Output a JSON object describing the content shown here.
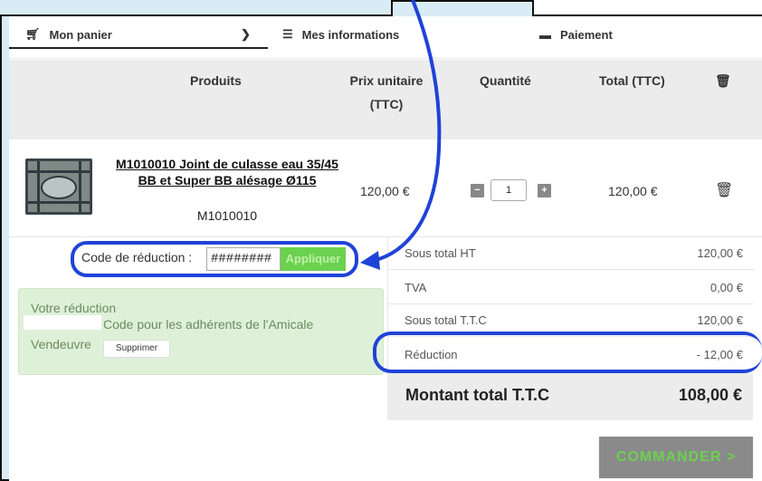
{
  "steps": [
    {
      "label": "Mon panier",
      "icon": "cart-icon"
    },
    {
      "label": "Mes informations",
      "icon": "list-icon"
    },
    {
      "label": "Paiement",
      "icon": "card-icon"
    }
  ],
  "table": {
    "headers": {
      "products": "Produits",
      "unit_price_line1": "Prix unitaire",
      "unit_price_line2": "(TTC)",
      "quantity": "Quantité",
      "total": "Total (TTC)"
    },
    "row": {
      "name": "M1010010 Joint de culasse eau 35/45 BB et Super BB alésage Ø115",
      "ref": "M1010010",
      "unit_price": "120,00 €",
      "quantity": "1",
      "total": "120,00 €"
    }
  },
  "discount": {
    "label": "Code de réduction :",
    "code_value": "########",
    "apply_label": "Appliquer",
    "box_title": "Votre réduction",
    "box_line2": "Code pour les adhérents de l'Amicale",
    "box_line3": "Vendeuvre",
    "remove_label": "Supprimer"
  },
  "totals": [
    {
      "label": "Sous total HT",
      "value": "120,00 €"
    },
    {
      "label": "TVA",
      "value": "0,00 €"
    },
    {
      "label": "Sous total T.T.C",
      "value": "120,00 €"
    },
    {
      "label": "Réduction",
      "value": "- 12,00 €"
    }
  ],
  "grand_total": {
    "label": "Montant total T.T.C",
    "value": "108,00 €"
  },
  "order_button": "COMMANDER  >",
  "colors": {
    "accent_green": "#6bd14f",
    "annotation_blue": "#1f43d8",
    "header_gray": "#ececec"
  }
}
